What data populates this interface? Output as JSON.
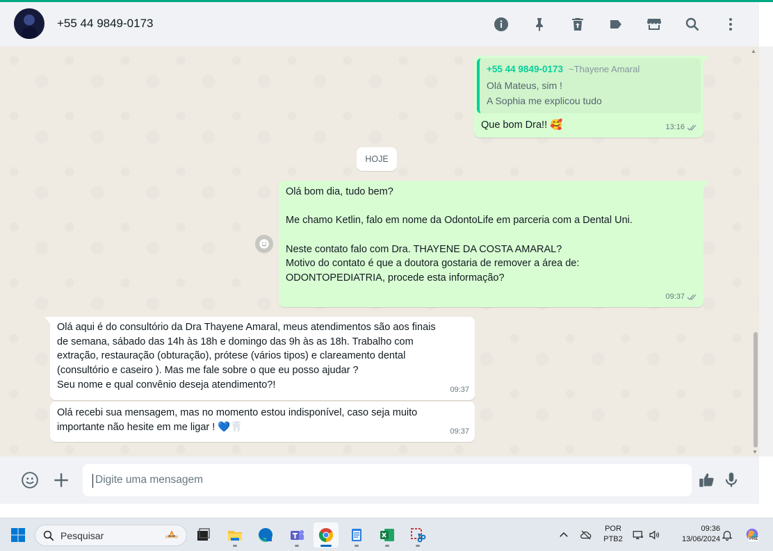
{
  "header": {
    "contact_name": "+55 44 9849-0173",
    "icons": [
      "info-icon",
      "pin-icon",
      "delete-icon",
      "label-icon",
      "store-icon",
      "search-icon",
      "menu-icon"
    ]
  },
  "messages": {
    "reply": {
      "quote_author": "+55 44 9849-0173",
      "quote_pushname": "~Thayene Amaral",
      "quote_line1": "Olá Mateus, sim !",
      "quote_line2": "A Sophia me explicou tudo",
      "text": "Que bom Dra!! 🥰",
      "time": "13:16"
    },
    "date_chip": "HOJE",
    "outgoing_long": {
      "p1": "Olá bom dia, tudo bem?",
      "p2": "Me chamo Ketlin, falo em nome da OdontoLife em parceria com a Dental Uni.",
      "p3": "Neste contato falo com Dra. THAYENE DA COSTA AMARAL?",
      "p4a": "Motivo do contato é que a doutora gostaria de remover a área de:",
      "p4b": "ODONTOPEDIATRIA, procede esta informação?",
      "time": "09:37"
    },
    "incoming_1": {
      "l1": "Olá aqui é do consultório da Dra Thayene Amaral, meus atendimentos são aos finais",
      "l2": "de semana, sábado das 14h às 18h e domingo das 9h às as 18h. Trabalho com",
      "l3": "extração, restauração (obturação), prótese (vários tipos) e clareamento dental",
      "l4": "(consultório e caseiro ). Mas me fale sobre o que eu posso ajudar ?",
      "l5": "Seu nome e qual convênio deseja atendimento?!",
      "time": "09:37"
    },
    "incoming_2": {
      "l1": "Olá recebi sua mensagem, mas no momento estou indisponível, caso seja muito",
      "l2": "importante não hesite em me ligar ! 💙🦷",
      "time": "09:37"
    }
  },
  "composer": {
    "placeholder": "Digite uma mensagem"
  },
  "taskbar": {
    "search_placeholder": "Pesquisar",
    "lang_top": "POR",
    "lang_bottom": "PTB2",
    "clock_time": "09:36",
    "clock_date": "13/06/2024",
    "copilot_badge": "PRE"
  },
  "colors": {
    "accent": "#00a884",
    "outgoing_bubble": "#d9fdd3",
    "quote_author": "#06cf9c"
  }
}
